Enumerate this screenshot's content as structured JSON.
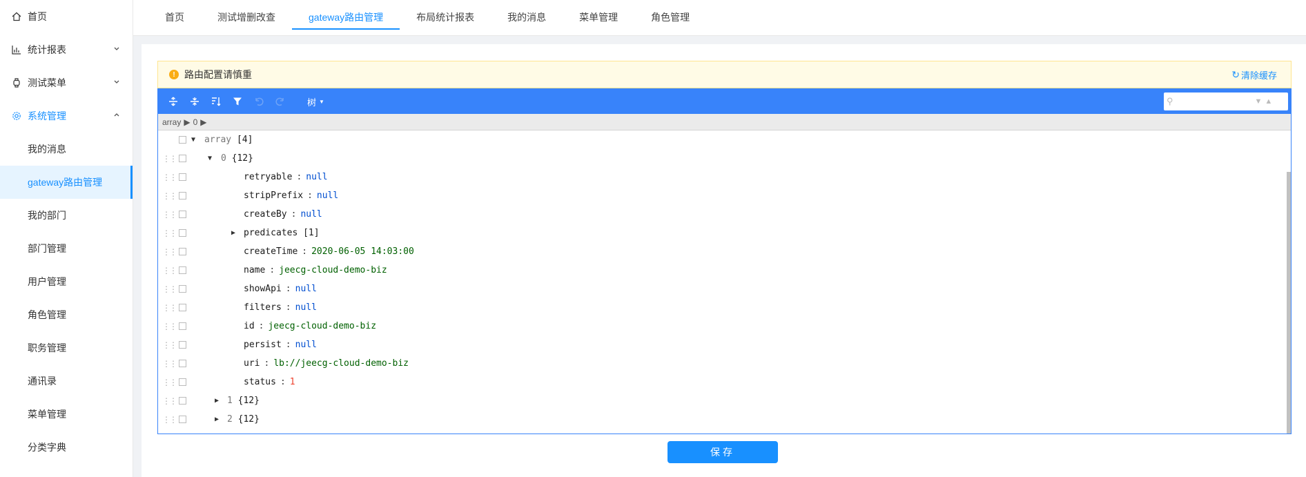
{
  "sidebar": {
    "items": [
      {
        "label": "首页",
        "icon": "home-icon"
      },
      {
        "label": "统计报表",
        "icon": "bar-chart-icon",
        "caret": "chevron-down"
      },
      {
        "label": "测试菜单",
        "icon": "watch-icon",
        "caret": "chevron-down"
      },
      {
        "label": "系统管理",
        "icon": "gear-icon",
        "caret": "chevron-up"
      }
    ],
    "submenu": [
      {
        "label": "我的消息"
      },
      {
        "label": "gateway路由管理"
      },
      {
        "label": "我的部门"
      },
      {
        "label": "部门管理"
      },
      {
        "label": "用户管理"
      },
      {
        "label": "角色管理"
      },
      {
        "label": "职务管理"
      },
      {
        "label": "通讯录"
      },
      {
        "label": "菜单管理"
      },
      {
        "label": "分类字典"
      }
    ],
    "selected_submenu": "gateway路由管理"
  },
  "tabs": [
    {
      "label": "首页"
    },
    {
      "label": "测试增删改查"
    },
    {
      "label": "gateway路由管理"
    },
    {
      "label": "布局统计报表"
    },
    {
      "label": "我的消息"
    },
    {
      "label": "菜单管理"
    },
    {
      "label": "角色管理"
    }
  ],
  "active_tab": "gateway路由管理",
  "alert": {
    "message": "路由配置请慎重",
    "clear_cache_label": "清除缓存"
  },
  "editor": {
    "mode_label": "树",
    "search_placeholder": "",
    "breadcrumb": [
      "array",
      "0"
    ],
    "root": {
      "key": "array",
      "count": "[4]"
    },
    "item0": {
      "index": "0",
      "count": "{12}"
    },
    "fields": [
      {
        "key": "retryable",
        "value": "null",
        "type": "null"
      },
      {
        "key": "stripPrefix",
        "value": "null",
        "type": "null"
      },
      {
        "key": "createBy",
        "value": "null",
        "type": "null"
      },
      {
        "key": "predicates",
        "value": "[1]",
        "type": "array"
      },
      {
        "key": "createTime",
        "value": "2020-06-05 14:03:00",
        "type": "string"
      },
      {
        "key": "name",
        "value": "jeecg-cloud-demo-biz",
        "type": "string"
      },
      {
        "key": "showApi",
        "value": "null",
        "type": "null"
      },
      {
        "key": "filters",
        "value": "null",
        "type": "null"
      },
      {
        "key": "id",
        "value": "jeecg-cloud-demo-biz",
        "type": "string"
      },
      {
        "key": "persist",
        "value": "null",
        "type": "null"
      },
      {
        "key": "uri",
        "value": "lb://jeecg-cloud-demo-biz",
        "type": "string"
      },
      {
        "key": "status",
        "value": "1",
        "type": "number"
      }
    ],
    "collapsed_items": [
      {
        "index": "1",
        "count": "{12}"
      },
      {
        "index": "2",
        "count": "{12}"
      }
    ]
  },
  "save_label": "保存",
  "colors": {
    "primary": "#1890ff",
    "editor_blue": "#3883fa",
    "alert_bg": "#fffbe6",
    "null_color": "#004ed0",
    "string_color": "#006000",
    "number_color": "#ee422e"
  }
}
